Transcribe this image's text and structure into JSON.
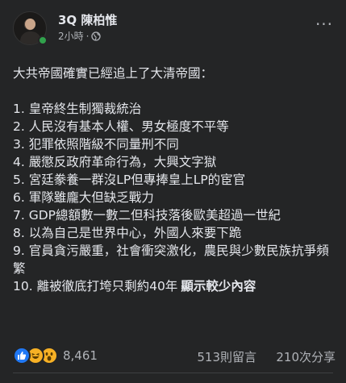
{
  "post": {
    "author": "3Q 陳柏惟",
    "timestamp": "2小時",
    "separator": "·",
    "privacy_icon": "globe-icon",
    "more_label": "···",
    "intro": "大共帝國確實已經追上了大清帝國：",
    "items": [
      "1. 皇帝終生制獨裁統治",
      "2. 人民沒有基本人權、男女極度不平等",
      "3. 犯罪依照階級不同量刑不同",
      "4. 嚴懲反政府革命行為，大興文字獄",
      "5. 宮廷豢養一群沒LP但專捧皇上LP的宦官",
      "6. 軍隊雖龐大但缺乏戰力",
      "7. GDP總額數一數二但科技落後歐美超過一世紀",
      "8. 以為自己是世界中心，外國人來要下跪",
      "9. 官員貪污嚴重，社會衝突激化，農民與少數民族抗爭頻繁",
      "10. 離被徹底打垮只剩約40年"
    ],
    "see_more": "顯示較少內容"
  },
  "footer": {
    "reaction_icons": [
      "like-icon",
      "haha-icon",
      "wow-icon"
    ],
    "reaction_count": "8,461",
    "comments": "513則留言",
    "shares": "210次分享"
  },
  "colors": {
    "background": "#242526",
    "text": "#e4e6eb",
    "secondary_text": "#b0b3b8",
    "online": "#31a24c",
    "like": "#2078f4",
    "haha": "#f7b125"
  }
}
